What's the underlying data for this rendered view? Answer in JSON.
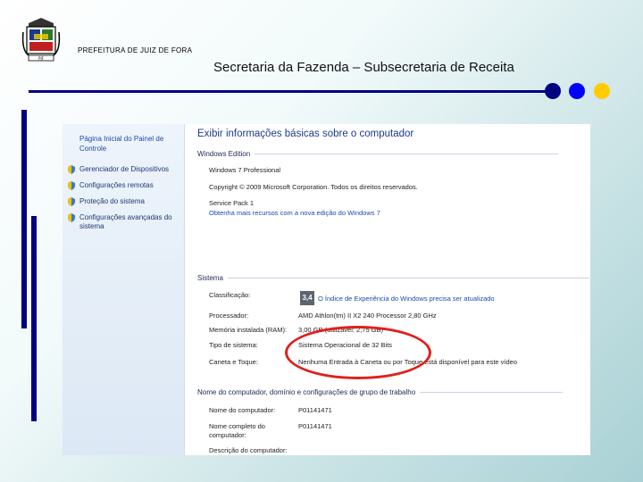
{
  "header": {
    "crest_label": "PJF",
    "city": "PREFEITURA  DE JUIZ DE FORA",
    "subtitle": "Secretaria da Fazenda – Subsecretaria de Receita"
  },
  "colors": {
    "navy": "#000080",
    "blue": "#0000ff",
    "yellow": "#ffcc00",
    "red_circle": "#e0201c"
  },
  "screenshot": {
    "sidebar": {
      "home": "Página Inicial do Painel de Controle",
      "items": [
        {
          "label": "Gerenciador de Dispositivos",
          "icon": "shield-icon"
        },
        {
          "label": "Configurações remotas",
          "icon": "shield-icon"
        },
        {
          "label": "Proteção do sistema",
          "icon": "shield-icon"
        },
        {
          "label": "Configurações avançadas do sistema",
          "icon": "shield-icon"
        }
      ]
    },
    "main": {
      "title": "Exibir informações básicas sobre o computador",
      "edition": {
        "heading": "Windows Edition",
        "name": "Windows 7 Professional",
        "copyright": "Copyright © 2009 Microsoft Corporation. Todos os direitos reservados.",
        "service_pack": "Service Pack 1",
        "more_link": "Obtenha mais recursos com a nova edição do Windows 7"
      },
      "system": {
        "heading": "Sistema",
        "rating_label": "Classificação:",
        "rating_score": "3,4",
        "rating_link": "O Índice de Experiência do Windows precisa ser atualizado",
        "processor_label": "Processador:",
        "processor_value": "AMD Athlon(tm) II X2 240 Processor   2,80 GHz",
        "memory_label": "Memória instalada (RAM):",
        "memory_value": "3,00 GB (utilizável: 2,75 GB)",
        "type_label": "Tipo de sistema:",
        "type_value": "Sistema Operacional de 32 Bits",
        "pen_label": "Caneta e Toque:",
        "pen_value": "Nenhuma Entrada à Caneta ou por Toque está disponível para este vídeo"
      },
      "computer": {
        "heading": "Nome do computador, domínio e configurações de grupo de trabalho",
        "name_label": "Nome do computador:",
        "name_value": "P01141471",
        "full_label": "Nome completo do computador:",
        "full_value": "P01141471",
        "desc_label": "Descrição do computador:"
      }
    }
  }
}
